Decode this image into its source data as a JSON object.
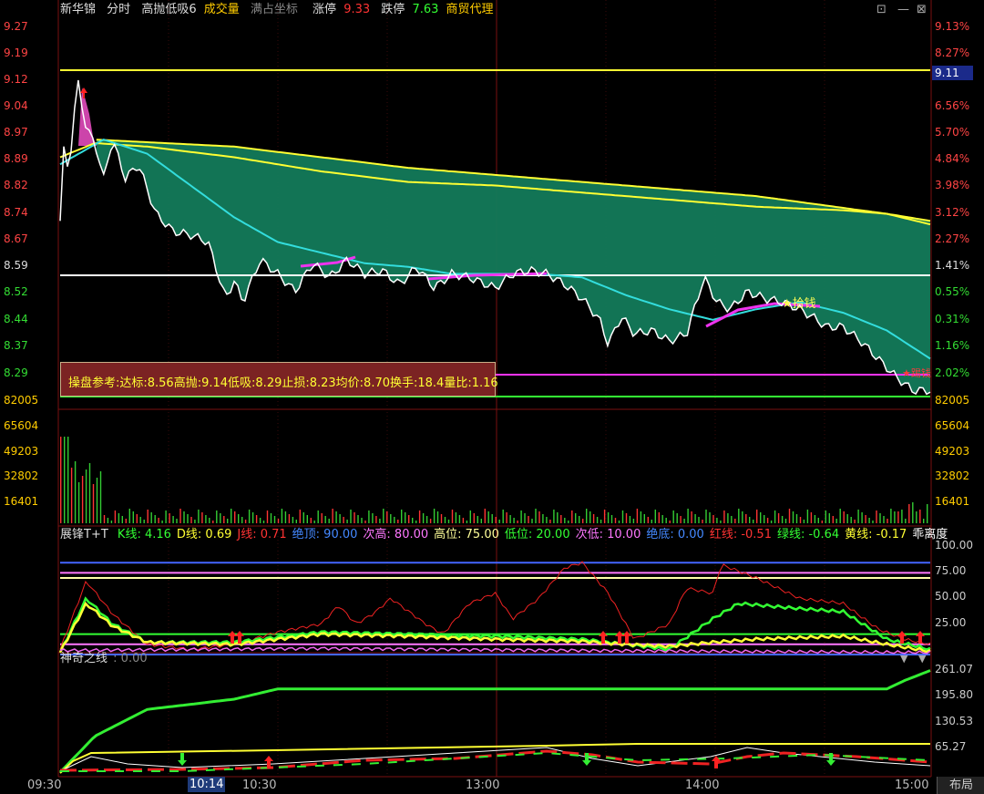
{
  "header": {
    "stock_name": "新华锦",
    "mode": "分时",
    "indicator": "高抛低吸6",
    "volume_label": "成交量",
    "full_axis_label": "满占坐标",
    "limit_up_label": "涨停",
    "limit_up_value": "9.33",
    "limit_down_label": "跌停",
    "limit_down_value": "7.63",
    "sector": "商贸代理",
    "icons": [
      "settings-icon",
      "minus-icon",
      "close-icon"
    ]
  },
  "price_axis": {
    "left": [
      "9.27",
      "9.19",
      "9.12",
      "9.04",
      "8.97",
      "8.89",
      "8.82",
      "8.74",
      "8.67",
      "8.59",
      "8.52",
      "8.44",
      "8.37",
      "8.29"
    ],
    "right": [
      "9.13%",
      "8.27%",
      "",
      "6.56%",
      "5.70%",
      "4.84%",
      "3.98%",
      "3.12%",
      "2.27%",
      "1.41%",
      "0.55%",
      "0.31%",
      "1.16%",
      "2.02%"
    ],
    "current_price_tag": "9.11"
  },
  "volume_axis": {
    "labels": [
      "82005",
      "65604",
      "49203",
      "32802",
      "16401"
    ]
  },
  "reference_box": {
    "text": "操盘参考:达标:8.56高抛:9.14低吸:8.29止损:8.23均价:8.70换手:18.4量比:1.16"
  },
  "signals": {
    "pickup_label": "★拾钱",
    "right_label": "★踢钱"
  },
  "indicator1": {
    "name": "展锋T+T",
    "items": [
      {
        "label": "K线:",
        "value": "4.16",
        "color": "#33ff33"
      },
      {
        "label": "D线:",
        "value": "0.69",
        "color": "#ffff33"
      },
      {
        "label": "J线:",
        "value": "0.71",
        "color": "#ff3333"
      },
      {
        "label": "绝顶:",
        "value": "90.00",
        "color": "#4488ff"
      },
      {
        "label": "次高:",
        "value": "80.00",
        "color": "#ff77ff"
      },
      {
        "label": "高位:",
        "value": "75.00",
        "color": "#ffff99"
      },
      {
        "label": "低位:",
        "value": "20.00",
        "color": "#33ff33"
      },
      {
        "label": "次低:",
        "value": "10.00",
        "color": "#ff77ff"
      },
      {
        "label": "绝底:",
        "value": "0.00",
        "color": "#4488ff"
      },
      {
        "label": "红线:",
        "value": "-0.51",
        "color": "#ff3333"
      },
      {
        "label": "绿线:",
        "value": "-0.64",
        "color": "#33ff33"
      },
      {
        "label": "黄线:",
        "value": "-0.17",
        "color": "#ffff33"
      },
      {
        "label": "乖离度",
        "value": "",
        "color": "#ffffff"
      }
    ],
    "axis": [
      "100.00",
      "75.00",
      "50.00",
      "25.00"
    ]
  },
  "indicator2": {
    "name": "神奇之线",
    "value": ": 0.00",
    "axis": [
      "261.07",
      "195.80",
      "130.53",
      "65.27"
    ]
  },
  "xaxis": {
    "labels": [
      "09:30",
      "10:30",
      "13:00",
      "14:00",
      "15:00"
    ],
    "cursor": "10:14",
    "layout_button": "布局"
  }
}
